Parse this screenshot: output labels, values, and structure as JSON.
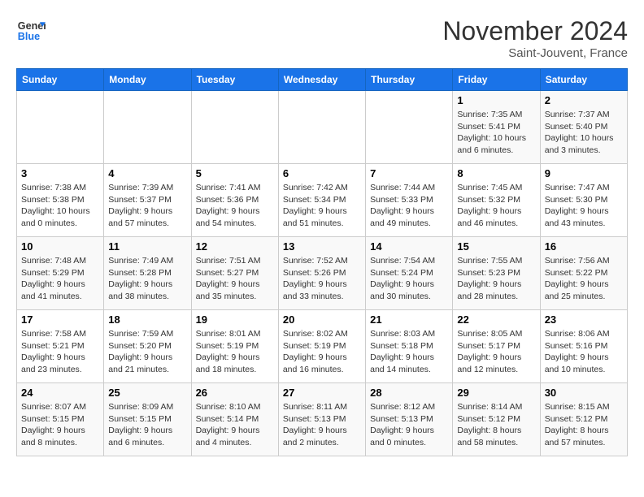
{
  "header": {
    "logo_line1": "General",
    "logo_line2": "Blue",
    "month": "November 2024",
    "location": "Saint-Jouvent, France"
  },
  "weekdays": [
    "Sunday",
    "Monday",
    "Tuesday",
    "Wednesday",
    "Thursday",
    "Friday",
    "Saturday"
  ],
  "weeks": [
    [
      {
        "day": "",
        "sunrise": "",
        "sunset": "",
        "daylight": ""
      },
      {
        "day": "",
        "sunrise": "",
        "sunset": "",
        "daylight": ""
      },
      {
        "day": "",
        "sunrise": "",
        "sunset": "",
        "daylight": ""
      },
      {
        "day": "",
        "sunrise": "",
        "sunset": "",
        "daylight": ""
      },
      {
        "day": "",
        "sunrise": "",
        "sunset": "",
        "daylight": ""
      },
      {
        "day": "1",
        "sunrise": "Sunrise: 7:35 AM",
        "sunset": "Sunset: 5:41 PM",
        "daylight": "Daylight: 10 hours and 6 minutes."
      },
      {
        "day": "2",
        "sunrise": "Sunrise: 7:37 AM",
        "sunset": "Sunset: 5:40 PM",
        "daylight": "Daylight: 10 hours and 3 minutes."
      }
    ],
    [
      {
        "day": "3",
        "sunrise": "Sunrise: 7:38 AM",
        "sunset": "Sunset: 5:38 PM",
        "daylight": "Daylight: 10 hours and 0 minutes."
      },
      {
        "day": "4",
        "sunrise": "Sunrise: 7:39 AM",
        "sunset": "Sunset: 5:37 PM",
        "daylight": "Daylight: 9 hours and 57 minutes."
      },
      {
        "day": "5",
        "sunrise": "Sunrise: 7:41 AM",
        "sunset": "Sunset: 5:36 PM",
        "daylight": "Daylight: 9 hours and 54 minutes."
      },
      {
        "day": "6",
        "sunrise": "Sunrise: 7:42 AM",
        "sunset": "Sunset: 5:34 PM",
        "daylight": "Daylight: 9 hours and 51 minutes."
      },
      {
        "day": "7",
        "sunrise": "Sunrise: 7:44 AM",
        "sunset": "Sunset: 5:33 PM",
        "daylight": "Daylight: 9 hours and 49 minutes."
      },
      {
        "day": "8",
        "sunrise": "Sunrise: 7:45 AM",
        "sunset": "Sunset: 5:32 PM",
        "daylight": "Daylight: 9 hours and 46 minutes."
      },
      {
        "day": "9",
        "sunrise": "Sunrise: 7:47 AM",
        "sunset": "Sunset: 5:30 PM",
        "daylight": "Daylight: 9 hours and 43 minutes."
      }
    ],
    [
      {
        "day": "10",
        "sunrise": "Sunrise: 7:48 AM",
        "sunset": "Sunset: 5:29 PM",
        "daylight": "Daylight: 9 hours and 41 minutes."
      },
      {
        "day": "11",
        "sunrise": "Sunrise: 7:49 AM",
        "sunset": "Sunset: 5:28 PM",
        "daylight": "Daylight: 9 hours and 38 minutes."
      },
      {
        "day": "12",
        "sunrise": "Sunrise: 7:51 AM",
        "sunset": "Sunset: 5:27 PM",
        "daylight": "Daylight: 9 hours and 35 minutes."
      },
      {
        "day": "13",
        "sunrise": "Sunrise: 7:52 AM",
        "sunset": "Sunset: 5:26 PM",
        "daylight": "Daylight: 9 hours and 33 minutes."
      },
      {
        "day": "14",
        "sunrise": "Sunrise: 7:54 AM",
        "sunset": "Sunset: 5:24 PM",
        "daylight": "Daylight: 9 hours and 30 minutes."
      },
      {
        "day": "15",
        "sunrise": "Sunrise: 7:55 AM",
        "sunset": "Sunset: 5:23 PM",
        "daylight": "Daylight: 9 hours and 28 minutes."
      },
      {
        "day": "16",
        "sunrise": "Sunrise: 7:56 AM",
        "sunset": "Sunset: 5:22 PM",
        "daylight": "Daylight: 9 hours and 25 minutes."
      }
    ],
    [
      {
        "day": "17",
        "sunrise": "Sunrise: 7:58 AM",
        "sunset": "Sunset: 5:21 PM",
        "daylight": "Daylight: 9 hours and 23 minutes."
      },
      {
        "day": "18",
        "sunrise": "Sunrise: 7:59 AM",
        "sunset": "Sunset: 5:20 PM",
        "daylight": "Daylight: 9 hours and 21 minutes."
      },
      {
        "day": "19",
        "sunrise": "Sunrise: 8:01 AM",
        "sunset": "Sunset: 5:19 PM",
        "daylight": "Daylight: 9 hours and 18 minutes."
      },
      {
        "day": "20",
        "sunrise": "Sunrise: 8:02 AM",
        "sunset": "Sunset: 5:19 PM",
        "daylight": "Daylight: 9 hours and 16 minutes."
      },
      {
        "day": "21",
        "sunrise": "Sunrise: 8:03 AM",
        "sunset": "Sunset: 5:18 PM",
        "daylight": "Daylight: 9 hours and 14 minutes."
      },
      {
        "day": "22",
        "sunrise": "Sunrise: 8:05 AM",
        "sunset": "Sunset: 5:17 PM",
        "daylight": "Daylight: 9 hours and 12 minutes."
      },
      {
        "day": "23",
        "sunrise": "Sunrise: 8:06 AM",
        "sunset": "Sunset: 5:16 PM",
        "daylight": "Daylight: 9 hours and 10 minutes."
      }
    ],
    [
      {
        "day": "24",
        "sunrise": "Sunrise: 8:07 AM",
        "sunset": "Sunset: 5:15 PM",
        "daylight": "Daylight: 9 hours and 8 minutes."
      },
      {
        "day": "25",
        "sunrise": "Sunrise: 8:09 AM",
        "sunset": "Sunset: 5:15 PM",
        "daylight": "Daylight: 9 hours and 6 minutes."
      },
      {
        "day": "26",
        "sunrise": "Sunrise: 8:10 AM",
        "sunset": "Sunset: 5:14 PM",
        "daylight": "Daylight: 9 hours and 4 minutes."
      },
      {
        "day": "27",
        "sunrise": "Sunrise: 8:11 AM",
        "sunset": "Sunset: 5:13 PM",
        "daylight": "Daylight: 9 hours and 2 minutes."
      },
      {
        "day": "28",
        "sunrise": "Sunrise: 8:12 AM",
        "sunset": "Sunset: 5:13 PM",
        "daylight": "Daylight: 9 hours and 0 minutes."
      },
      {
        "day": "29",
        "sunrise": "Sunrise: 8:14 AM",
        "sunset": "Sunset: 5:12 PM",
        "daylight": "Daylight: 8 hours and 58 minutes."
      },
      {
        "day": "30",
        "sunrise": "Sunrise: 8:15 AM",
        "sunset": "Sunset: 5:12 PM",
        "daylight": "Daylight: 8 hours and 57 minutes."
      }
    ]
  ]
}
